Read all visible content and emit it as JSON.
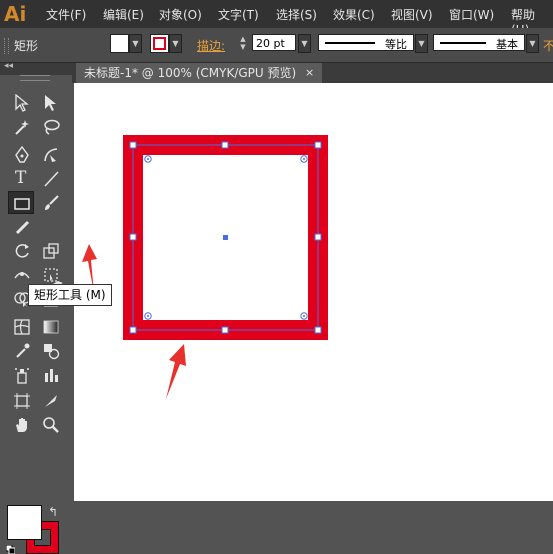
{
  "app": {
    "logo": "Ai"
  },
  "menu": [
    "文件(F)",
    "编辑(E)",
    "对象(O)",
    "文字(T)",
    "选择(S)",
    "效果(C)",
    "视图(V)",
    "窗口(W)",
    "帮助(H)"
  ],
  "control": {
    "shape_label": "矩形",
    "stroke_label": "描边",
    "stroke_colon": ":",
    "stroke_weight": "20 pt",
    "profile_label": "等比",
    "brush_label": "基本",
    "cut_label": "不"
  },
  "document": {
    "tab_title": "未标题-1* @ 100% (CMYK/GPU 预览)",
    "close_glyph": "×"
  },
  "toolbox": {
    "collapse_glyph": "◂◂",
    "tooltip": "矩形工具 (M)",
    "type_tool_glyph": "T"
  },
  "colors": {
    "stroke": "#e0001b",
    "fill": "#ffffff",
    "selection": "#4a6ee0",
    "annotation": "#e8312d"
  }
}
